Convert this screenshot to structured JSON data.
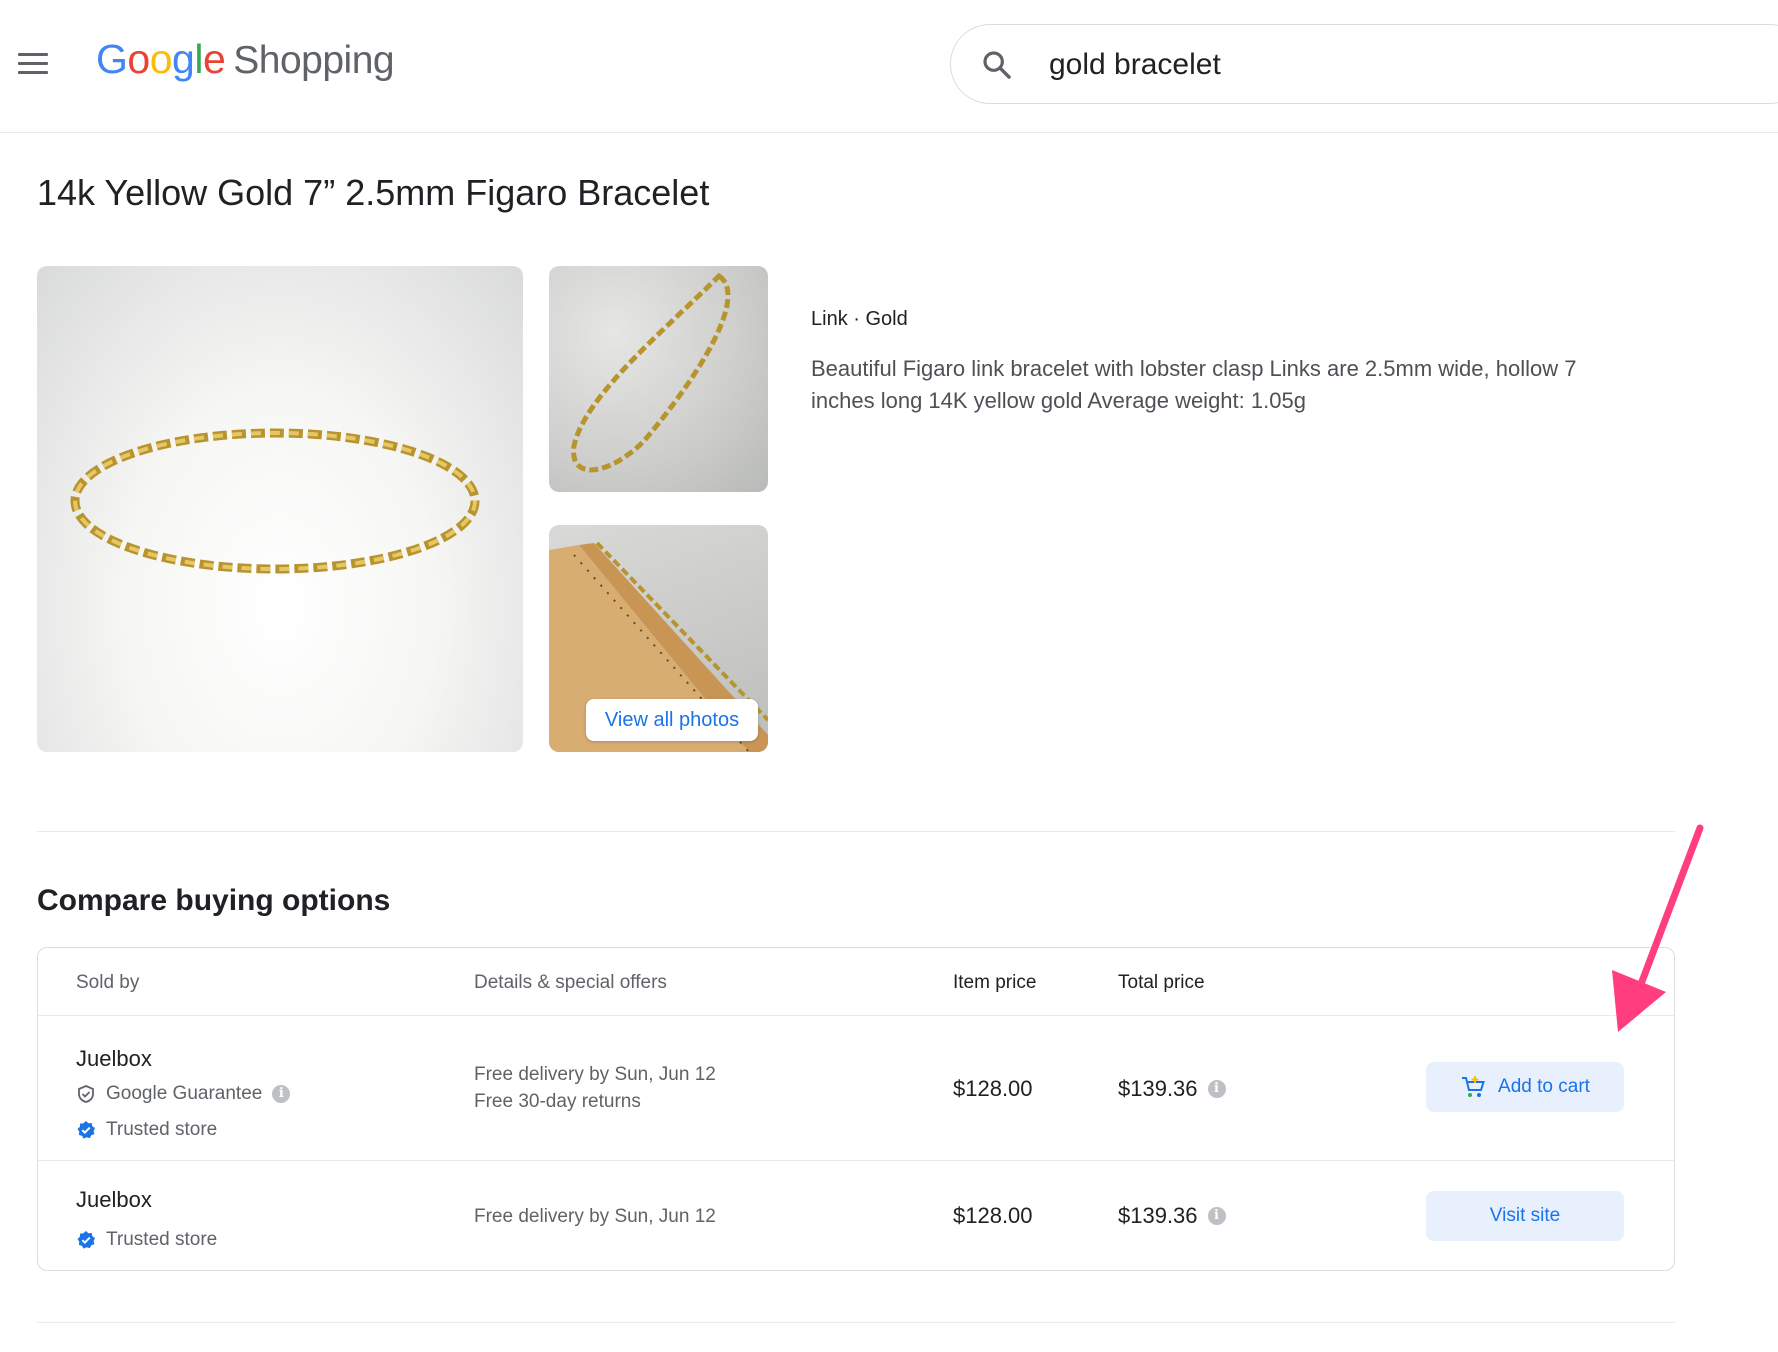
{
  "header": {
    "logo_letters": [
      "G",
      "o",
      "o",
      "g",
      "l",
      "e"
    ],
    "logo_product": "Shopping",
    "search_value": "gold bracelet"
  },
  "product": {
    "title": "14k Yellow Gold 7” 2.5mm Figaro Bracelet",
    "attributes": "Link · Gold",
    "description": "Beautiful Figaro link bracelet with lobster clasp Links are 2.5mm wide, hollow 7 inches long 14K yellow gold Average weight: 1.05g",
    "view_all_photos": "View all photos"
  },
  "compare": {
    "title": "Compare buying options",
    "columns": {
      "sold_by": "Sold by",
      "details": "Details & special offers",
      "item_price": "Item price",
      "total_price": "Total price"
    },
    "offers": [
      {
        "seller": "Juelbox",
        "google_guarantee": "Google Guarantee",
        "trusted_store": "Trusted store",
        "details": [
          "Free delivery by Sun, Jun 12",
          "Free 30-day returns"
        ],
        "item_price": "$128.00",
        "total_price": "$139.36",
        "action": "Add to cart"
      },
      {
        "seller": "Juelbox",
        "trusted_store": "Trusted store",
        "details": [
          "Free delivery by Sun, Jun 12"
        ],
        "item_price": "$128.00",
        "total_price": "$139.36",
        "action": "Visit site"
      }
    ]
  },
  "colors": {
    "accent_blue": "#1a73e8",
    "button_bg": "#e8f0fe",
    "annotation_arrow": "#ff3d7f"
  },
  "icons": [
    "menu-icon",
    "search-icon",
    "shield-check-icon",
    "verified-icon",
    "info-icon",
    "cart-icon"
  ]
}
